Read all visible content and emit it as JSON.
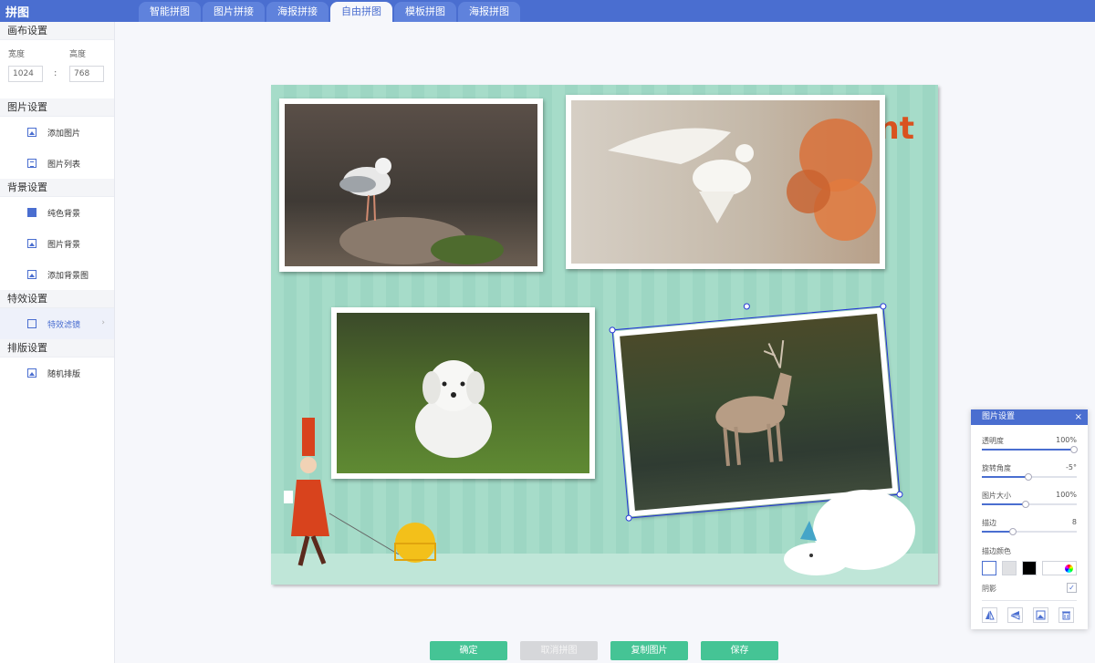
{
  "app": {
    "title": "拼图"
  },
  "tabs": [
    {
      "label": "智能拼图",
      "active": false
    },
    {
      "label": "图片拼接",
      "active": false
    },
    {
      "label": "海报拼接",
      "active": false
    },
    {
      "label": "自由拼图",
      "active": true
    },
    {
      "label": "模板拼图",
      "active": false
    },
    {
      "label": "海报拼图",
      "active": false
    }
  ],
  "sidebar": {
    "canvas": {
      "title": "画布设置",
      "width_label": "宽度",
      "height_label": "高度",
      "width_value": "1024",
      "height_value": "768",
      "separator": ":"
    },
    "image_settings": {
      "title": "图片设置",
      "items": [
        {
          "label": "添加图片",
          "icon": "image-icon"
        },
        {
          "label": "图片列表",
          "icon": "list-icon"
        }
      ]
    },
    "background": {
      "title": "背景设置",
      "items": [
        {
          "label": "纯色背景",
          "icon": "solid-color-icon"
        },
        {
          "label": "图片背景",
          "icon": "image-icon"
        },
        {
          "label": "添加背景图",
          "icon": "add-background-icon"
        }
      ]
    },
    "effects": {
      "title": "特效设置",
      "items": [
        {
          "label": "特效滤镜",
          "icon": "filter-icon",
          "active": true
        }
      ],
      "chevron": "›"
    },
    "layout": {
      "title": "排版设置",
      "items": [
        {
          "label": "随机排版",
          "icon": "shuffle-icon"
        }
      ]
    }
  },
  "canvas": {
    "decoration_text": "nt",
    "photos": [
      {
        "subject": "seagull"
      },
      {
        "subject": "dove"
      },
      {
        "subject": "puppy"
      },
      {
        "subject": "deer",
        "selected": true,
        "rotation_deg": -5
      }
    ]
  },
  "panel": {
    "title": "图片设置",
    "close": "×",
    "sliders": [
      {
        "label": "透明度",
        "value": "100%",
        "fraction": 0.97
      },
      {
        "label": "旋转角度",
        "value": "-5°",
        "fraction": 0.49
      },
      {
        "label": "图片大小",
        "value": "100%",
        "fraction": 0.46
      },
      {
        "label": "描边",
        "value": "8",
        "fraction": 0.33
      }
    ],
    "stroke_color_label": "描边颜色",
    "swatch_colors": [
      "#ffffff",
      "#e0e1e4",
      "#000000"
    ],
    "shadow_label": "阴影",
    "shadow_checked": "✓",
    "tools": [
      "flip-horizontal-icon",
      "flip-vertical-icon",
      "replace-image-icon",
      "delete-icon"
    ]
  },
  "buttons": {
    "confirm": "确定",
    "cancel": "取消拼图",
    "copy": "复制图片",
    "save": "保存"
  },
  "colors": {
    "accent": "#4a6ed0",
    "button_green": "#45c495",
    "selection": "#2336d6"
  }
}
